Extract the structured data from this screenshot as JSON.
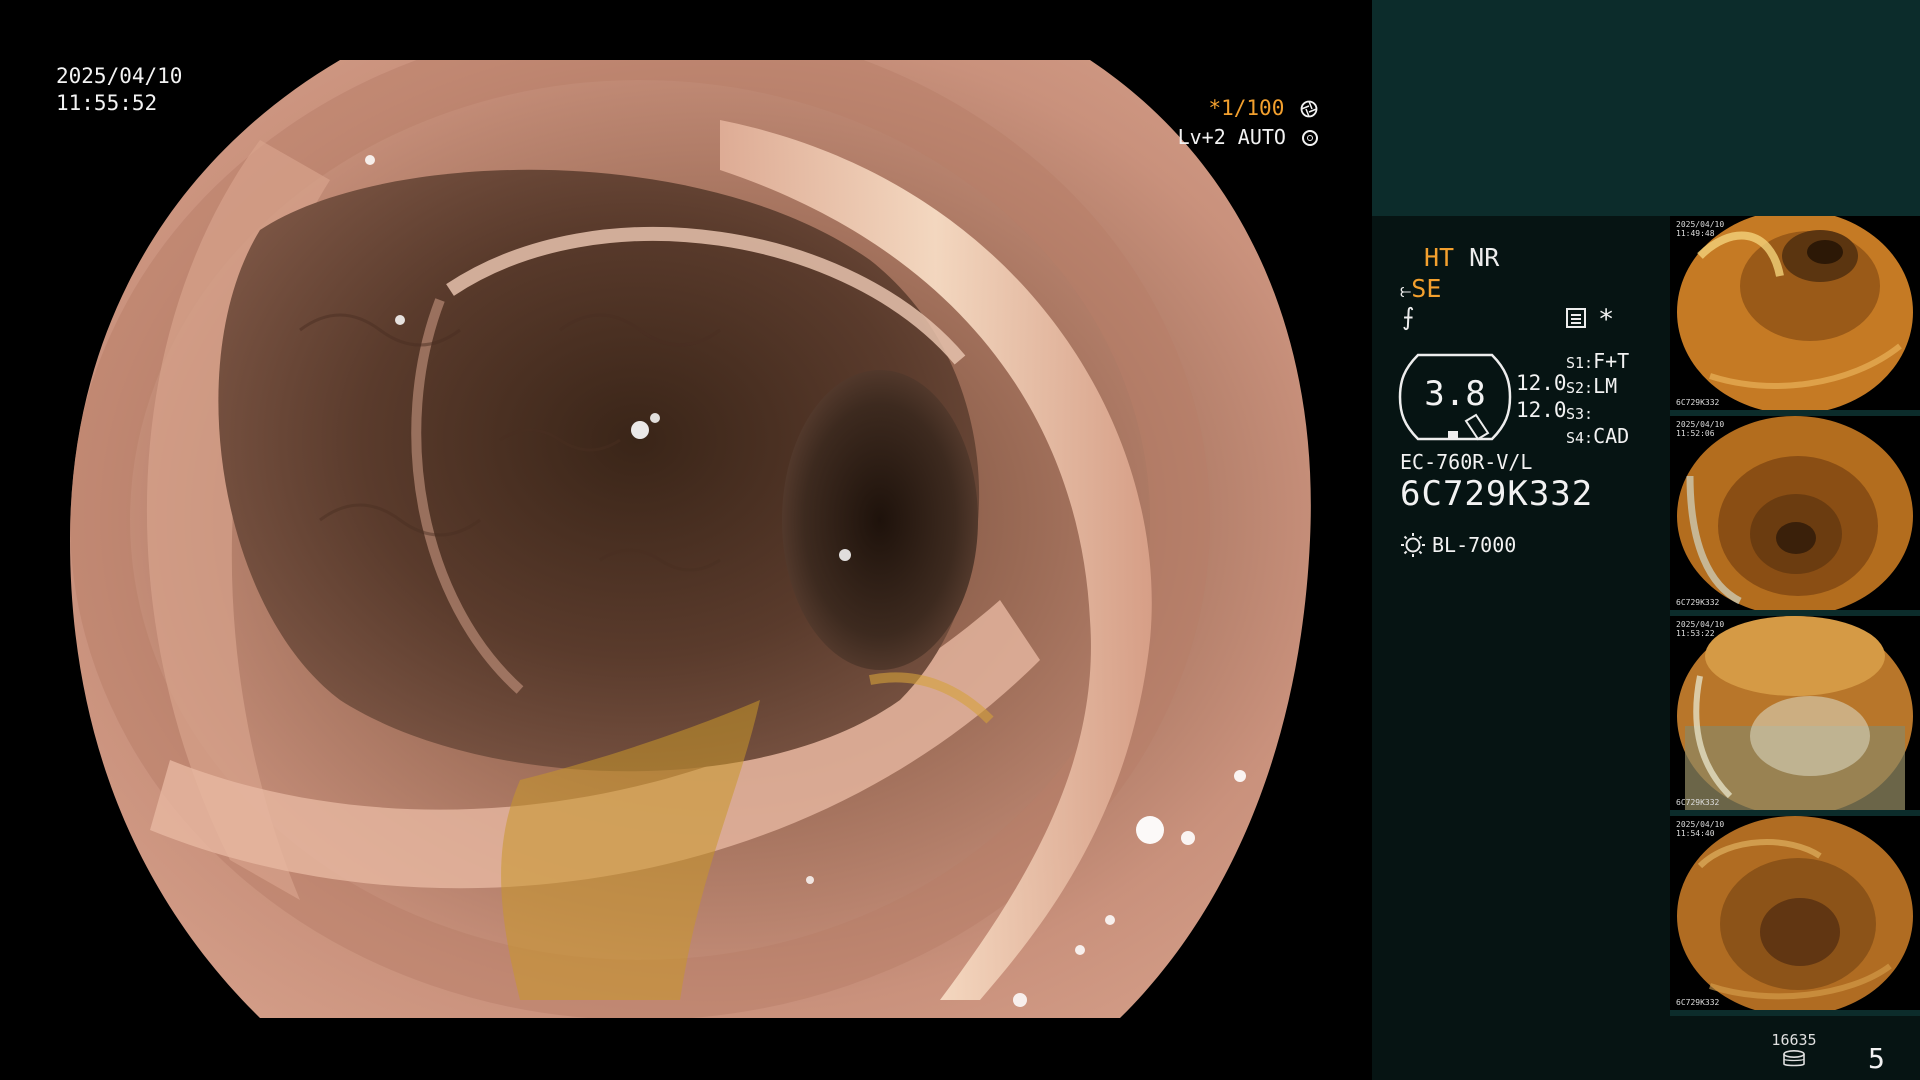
{
  "overlay": {
    "date": "2025/04/10",
    "time": "11:55:52",
    "shutter": "*1/100",
    "level_label": "Lv+2 AUTO"
  },
  "panel": {
    "ht_label": "HT",
    "nr_label": "NR",
    "se_label": "SE",
    "gauge_value": "3.8",
    "side_values": [
      "12.0",
      "12.0"
    ],
    "slots": [
      {
        "key": "S1:",
        "value": "F+T"
      },
      {
        "key": "S2:",
        "value": "LM"
      },
      {
        "key": "S3:",
        "value": ""
      },
      {
        "key": "S4:",
        "value": "CAD"
      }
    ],
    "scope_model": "EC-760R-V/L",
    "scope_serial": "6C729K332",
    "light_source": "BL-7000",
    "image_counter": "16635",
    "page_number": "5"
  },
  "thumbnails": [
    {
      "stamp_date": "2025/04/10",
      "stamp_time": "11:49:48",
      "serial": "6C729K332"
    },
    {
      "stamp_date": "2025/04/10",
      "stamp_time": "11:52:06",
      "serial": "6C729K332"
    },
    {
      "stamp_date": "2025/04/10",
      "stamp_time": "11:53:22",
      "serial": "6C729K332"
    },
    {
      "stamp_date": "2025/04/10",
      "stamp_time": "11:54:40",
      "serial": "6C729K332"
    }
  ],
  "colors": {
    "accent_orange": "#f3a02e",
    "panel_top": "#0c2c2b",
    "panel_bg": "#061413"
  },
  "icons": [
    "aperture-icon",
    "target-icon",
    "pump-icon",
    "menu-icon",
    "asterisk-icon",
    "sun-icon",
    "database-icon"
  ]
}
